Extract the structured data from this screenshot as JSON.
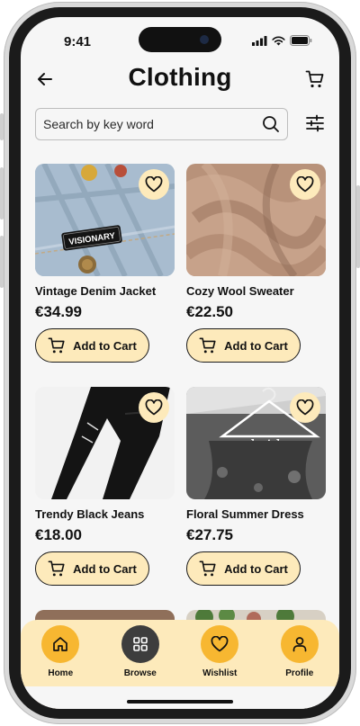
{
  "status_bar": {
    "time": "9:41"
  },
  "header": {
    "title": "Clothing"
  },
  "search": {
    "placeholder": "Search by key word"
  },
  "products": [
    {
      "name": "Vintage Denim Jacket",
      "price": "€34.99",
      "add_label": "Add to Cart",
      "patch_text": "VISIONARY"
    },
    {
      "name": "Cozy Wool Sweater",
      "price": "€22.50",
      "add_label": "Add to Cart"
    },
    {
      "name": "Trendy Black Jeans",
      "price": "€18.00",
      "add_label": "Add to Cart"
    },
    {
      "name": "Floral Summer Dress",
      "price": "€27.75",
      "add_label": "Add to Cart",
      "hanger_text": "bride"
    }
  ],
  "nav": {
    "items": [
      {
        "label": "Home",
        "icon": "home-icon"
      },
      {
        "label": "Browse",
        "icon": "grid-icon",
        "active": true
      },
      {
        "label": "Wishlist",
        "icon": "heart-icon"
      },
      {
        "label": "Profile",
        "icon": "user-icon"
      }
    ]
  },
  "colors": {
    "accent": "#f7b731",
    "accent_light": "#fdeabb",
    "active_nav": "#3d3d3d",
    "background": "#f6f6f6"
  }
}
